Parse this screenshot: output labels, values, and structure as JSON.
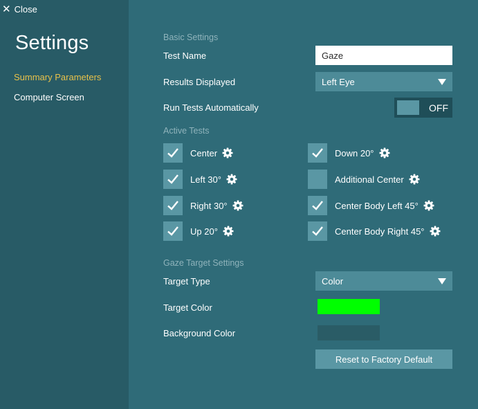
{
  "sidebar": {
    "close_label": "Close",
    "title": "Settings",
    "items": [
      {
        "label": "Summary Parameters",
        "active": true
      },
      {
        "label": "Computer Screen",
        "active": false
      }
    ]
  },
  "basic": {
    "section_title": "Basic Settings",
    "test_name_label": "Test Name",
    "test_name_value": "Gaze",
    "results_label": "Results Displayed",
    "results_value": "Left Eye",
    "run_auto_label": "Run Tests Automatically",
    "run_auto_state": "OFF"
  },
  "active_tests": {
    "section_title": "Active Tests",
    "left_column": [
      {
        "label": "Center",
        "checked": true
      },
      {
        "label": "Left 30°",
        "checked": true
      },
      {
        "label": "Right 30°",
        "checked": true
      },
      {
        "label": "Up 20°",
        "checked": true
      }
    ],
    "right_column": [
      {
        "label": "Down 20°",
        "checked": true
      },
      {
        "label": "Additional Center",
        "checked": false
      },
      {
        "label": "Center Body Left 45°",
        "checked": true
      },
      {
        "label": "Center Body Right 45°",
        "checked": true
      }
    ]
  },
  "gaze_target": {
    "section_title": "Gaze Target Settings",
    "target_type_label": "Target Type",
    "target_type_value": "Color",
    "target_color_label": "Target Color",
    "target_color": "#00ff00",
    "background_color_label": "Background Color",
    "background_color": "#2a5c66",
    "reset_label": "Reset to Factory Default"
  },
  "colors": {
    "sidebar_bg": "#285b66",
    "main_bg": "#2f6b78",
    "accent": "#e8c14a"
  }
}
